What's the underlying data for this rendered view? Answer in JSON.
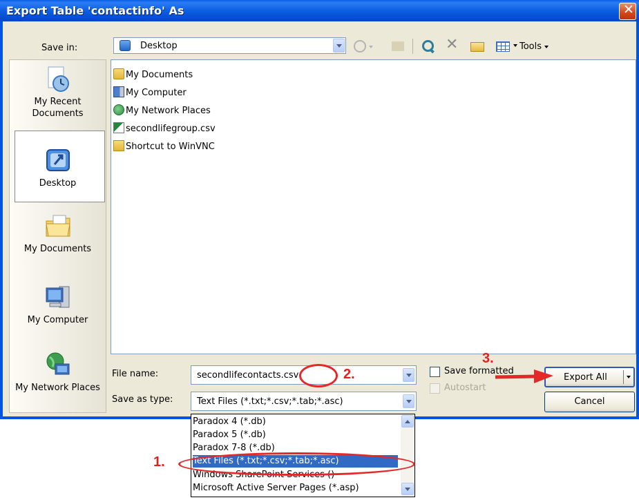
{
  "window": {
    "title": "Export Table 'contactinfo' As",
    "close_glyph": "✕"
  },
  "save_in": {
    "label": "Save in:",
    "value": "Desktop",
    "icon": "desktop-icon"
  },
  "toolbar": {
    "icons": [
      "back-icon",
      "up-folder-icon",
      "search-web-icon",
      "delete-icon",
      "new-folder-icon",
      "views-icon"
    ],
    "tools_label": "Tools"
  },
  "places": [
    {
      "label": "My Recent Documents",
      "icon": "recent-documents-icon"
    },
    {
      "label": "Desktop",
      "icon": "desktop-icon",
      "selected": true
    },
    {
      "label": "My Documents",
      "icon": "my-documents-icon"
    },
    {
      "label": "My Computer",
      "icon": "my-computer-icon"
    },
    {
      "label": "My Network Places",
      "icon": "network-places-icon"
    }
  ],
  "files": [
    {
      "name": "My Documents",
      "icon": "my-documents-icon"
    },
    {
      "name": "My Computer",
      "icon": "my-computer-icon"
    },
    {
      "name": "My Network Places",
      "icon": "network-places-icon"
    },
    {
      "name": "secondlifegroup.csv",
      "icon": "csv-file-icon"
    },
    {
      "name": "Shortcut to WinVNC",
      "icon": "shortcut-folder-icon"
    }
  ],
  "file_name": {
    "label": "File name:",
    "value": "secondlifecontacts.csv"
  },
  "save_as_type": {
    "label": "Save as type:",
    "value": "Text Files (*.txt;*.csv;*.tab;*.asc)",
    "options": [
      "Paradox 4 (*.db)",
      "Paradox 5 (*.db)",
      "Paradox 7-8 (*.db)",
      "Text Files (*.txt;*.csv;*.tab;*.asc)",
      "Windows SharePoint Services ()",
      "Microsoft Active Server Pages (*.asp)"
    ],
    "selected_option": "Text Files (*.txt;*.csv;*.tab;*.asc)"
  },
  "checkboxes": {
    "save_formatted": {
      "label": "Save formatted",
      "checked": false
    },
    "autostart": {
      "label": "Autostart",
      "checked": false,
      "disabled": true
    }
  },
  "buttons": {
    "export_all": "Export All",
    "cancel": "Cancel"
  },
  "annotations": {
    "step1": "1.",
    "step2": "2.",
    "step3": "3.",
    "color": "#e3282a"
  }
}
